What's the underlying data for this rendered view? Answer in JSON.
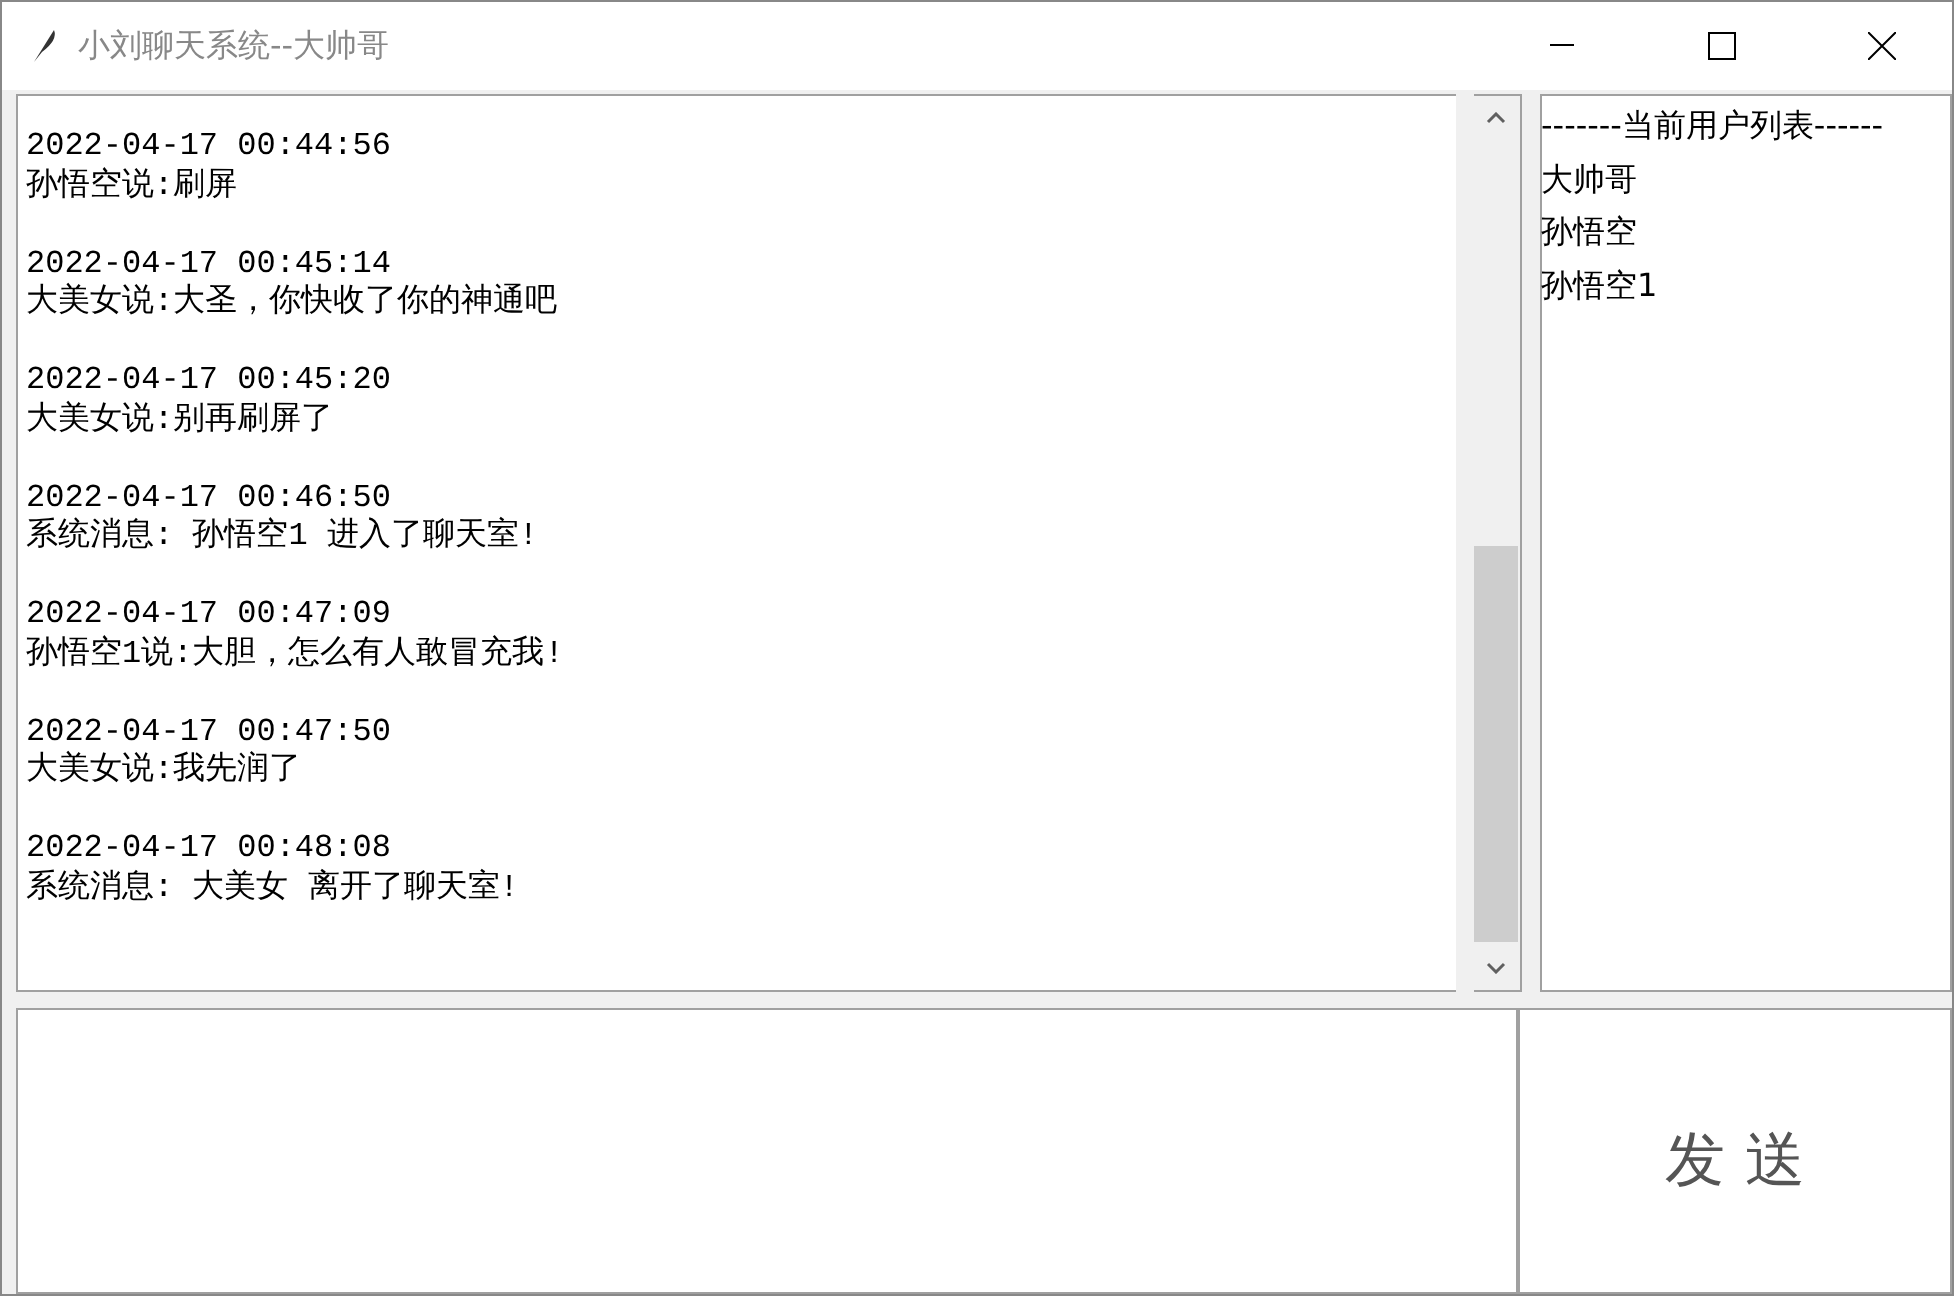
{
  "window": {
    "title": "小刘聊天系统--大帅哥"
  },
  "messages": [
    {
      "time": "2022-04-17 00:44:56",
      "text": "孙悟空说:刷屏"
    },
    {
      "time": "2022-04-17 00:45:14",
      "text": "大美女说:大圣，你快收了你的神通吧"
    },
    {
      "time": "2022-04-17 00:45:20",
      "text": "大美女说:别再刷屏了"
    },
    {
      "time": "2022-04-17 00:46:50",
      "text": "系统消息: 孙悟空1 进入了聊天室!"
    },
    {
      "time": "2022-04-17 00:47:09",
      "text": "孙悟空1说:大胆，怎么有人敢冒充我!"
    },
    {
      "time": "2022-04-17 00:47:50",
      "text": "大美女说:我先润了"
    },
    {
      "time": "2022-04-17 00:48:08",
      "text": "系统消息: 大美女 离开了聊天室!"
    }
  ],
  "user_list": {
    "header": "-------当前用户列表------",
    "users": [
      "大帅哥",
      "孙悟空",
      "孙悟空1"
    ]
  },
  "send_button": "发 送"
}
